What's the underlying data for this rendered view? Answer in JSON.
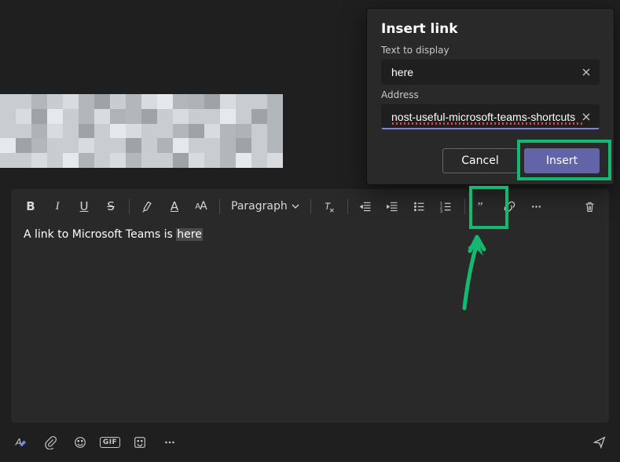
{
  "dialog": {
    "title": "Insert link",
    "text_label": "Text to display",
    "text_value": "here",
    "address_label": "Address",
    "address_value": "nost-useful-microsoft-teams-shortcuts/",
    "cancel": "Cancel",
    "insert": "Insert"
  },
  "toolbar": {
    "paragraph_label": "Paragraph"
  },
  "editor": {
    "text_prefix": "A link to Microsoft Teams is ",
    "selected_word": "here"
  },
  "bottombar": {
    "gif_label": "GIF"
  }
}
